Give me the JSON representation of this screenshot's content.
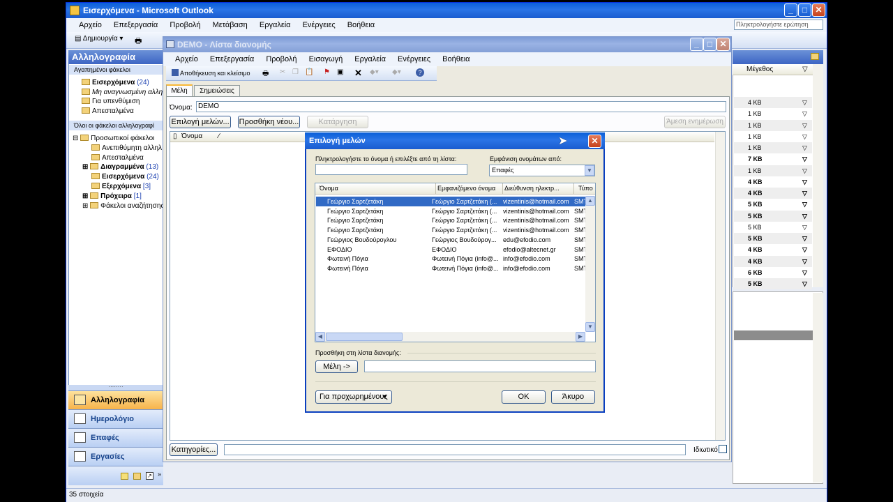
{
  "outlook": {
    "title": "Εισερχόμενα - Microsoft Outlook",
    "menu": [
      "Αρχείο",
      "Επεξεργασία",
      "Προβολή",
      "Μετάβαση",
      "Εργαλεία",
      "Ενέργειες",
      "Βοήθεια"
    ],
    "help_box": "Πληκτρολογήστε ερώτηση",
    "new_button": "Δημιουργία",
    "pane_title": "Αλληλογραφία",
    "favorites_header": "Αγαπημένοι φάκελοι",
    "favorites": [
      {
        "label": "Εισερχόμενα",
        "count": "(24)",
        "bold": true
      },
      {
        "label": "Μη αναγνωσμένη αλληλ",
        "count": "",
        "italic": true
      },
      {
        "label": "Για υπενθύμιση",
        "count": ""
      },
      {
        "label": "Απεσταλμένα",
        "count": ""
      }
    ],
    "all_folders_header": "Όλοι οι φάκελοι αλληλογραφί",
    "folders": [
      {
        "label": "Προσωπικοί φάκελοι",
        "count": ""
      },
      {
        "label": "Ανεπιθύμητη αλληλ",
        "count": ""
      },
      {
        "label": "Απεσταλμένα",
        "count": ""
      },
      {
        "label": "Διαγραμμένα",
        "count": "(13)",
        "bold": true
      },
      {
        "label": "Εισερχόμενα",
        "count": "(24)",
        "bold": true
      },
      {
        "label": "Εξερχόμενα",
        "count": "[3]",
        "bold": true
      },
      {
        "label": "Πρόχειρα",
        "count": "[1]",
        "bold": true
      },
      {
        "label": "Φάκελοι αναζήτησης",
        "count": ""
      }
    ],
    "nav": [
      "Αλληλογραφία",
      "Ημερολόγιο",
      "Επαφές",
      "Εργασίες"
    ],
    "size_header": "Μέγεθος",
    "sizes": [
      {
        "v": "4 KB",
        "b": false
      },
      {
        "v": "1 KB",
        "b": false
      },
      {
        "v": "1 KB",
        "b": false
      },
      {
        "v": "1 KB",
        "b": false
      },
      {
        "v": "1 KB",
        "b": false
      },
      {
        "v": "7 KB",
        "b": true
      },
      {
        "v": "1 KB",
        "b": false
      },
      {
        "v": "4 KB",
        "b": true
      },
      {
        "v": "4 KB",
        "b": true
      },
      {
        "v": "5 KB",
        "b": true
      },
      {
        "v": "5 KB",
        "b": true
      },
      {
        "v": "5 KB",
        "b": false
      },
      {
        "v": "5 KB",
        "b": true
      },
      {
        "v": "4 KB",
        "b": true
      },
      {
        "v": "4 KB",
        "b": true
      },
      {
        "v": "6 KB",
        "b": true
      },
      {
        "v": "5 KB",
        "b": true
      }
    ],
    "status": "35 στοιχεία"
  },
  "dl": {
    "title": "DEMO - Λίστα διανομής",
    "menu": [
      "Αρχείο",
      "Επεξεργασία",
      "Προβολή",
      "Εισαγωγή",
      "Εργαλεία",
      "Ενέργειες",
      "Βοήθεια"
    ],
    "save_close": "Αποθήκευση και κλείσιμο",
    "tabs": [
      "Μέλη",
      "Σημειώσεις"
    ],
    "name_label": "Όνομα:",
    "name_value": "DEMO",
    "select_members": "Επιλογή μελών...",
    "add_new": "Προσθήκη νέου...",
    "remove": "Κατάργηση",
    "update_now": "Άμεση ενημέρωση",
    "col_name": "Όνομα",
    "categories": "Κατηγορίες...",
    "private": "Ιδιωτικό"
  },
  "dialog": {
    "title": "Επιλογή μελών",
    "search_label": "Πληκτρολογήστε το όνομα ή επιλέξτε από τη λίστα:",
    "show_names_label": "Εμφάνιση ονομάτων από:",
    "source": "Επαφές",
    "columns": [
      "Όνομα",
      "Εμφανιζόμενο όνομα",
      "Διεύθυνση ηλεκτρ...",
      "Τύπο"
    ],
    "rows": [
      [
        "Γεώργιο Σαρτζετάκη",
        "Γεώργιο Σαρτζετάκη (...",
        "vizentinis@hotmail.com",
        "SMT"
      ],
      [
        "Γεώργιο Σαρτζετάκη",
        "Γεώργιο Σαρτζετάκη (...",
        "vizentinis@hotmail.com",
        "SMT"
      ],
      [
        "Γεώργιο Σαρτζετάκη",
        "Γεώργιο Σαρτζετάκη (...",
        "vizentinis@hotmail.com",
        "SMT"
      ],
      [
        "Γεώργιο Σαρτζετάκη",
        "Γεώργιο Σαρτζετάκη (...",
        "vizentinis@hotmail.com",
        "SMT"
      ],
      [
        "Γεώργιος Βουδούρογλου",
        "Γεώργιος Βουδούρογ...",
        "edu@efodio.com",
        "SMT"
      ],
      [
        "ΕΦΟΔΙΟ",
        "ΕΦΟΔΙΟ",
        "efodio@altecnet.gr",
        "SMT"
      ],
      [
        "Φωτεινή Πόγια",
        "Φωτεινή Πόγια (info@...",
        "info@efodio.com",
        "SMT"
      ],
      [
        "Φωτεινή Πόγια",
        "Φωτεινή Πόγια (info@...",
        "info@efodio.com",
        "SMT"
      ]
    ],
    "add_label": "Προσθήκη στη λίστα διανομής:",
    "members_button": "Μέλη ->",
    "advanced": "Για προχωρημένους",
    "ok": "ΟΚ",
    "cancel": "Άκυρο"
  }
}
